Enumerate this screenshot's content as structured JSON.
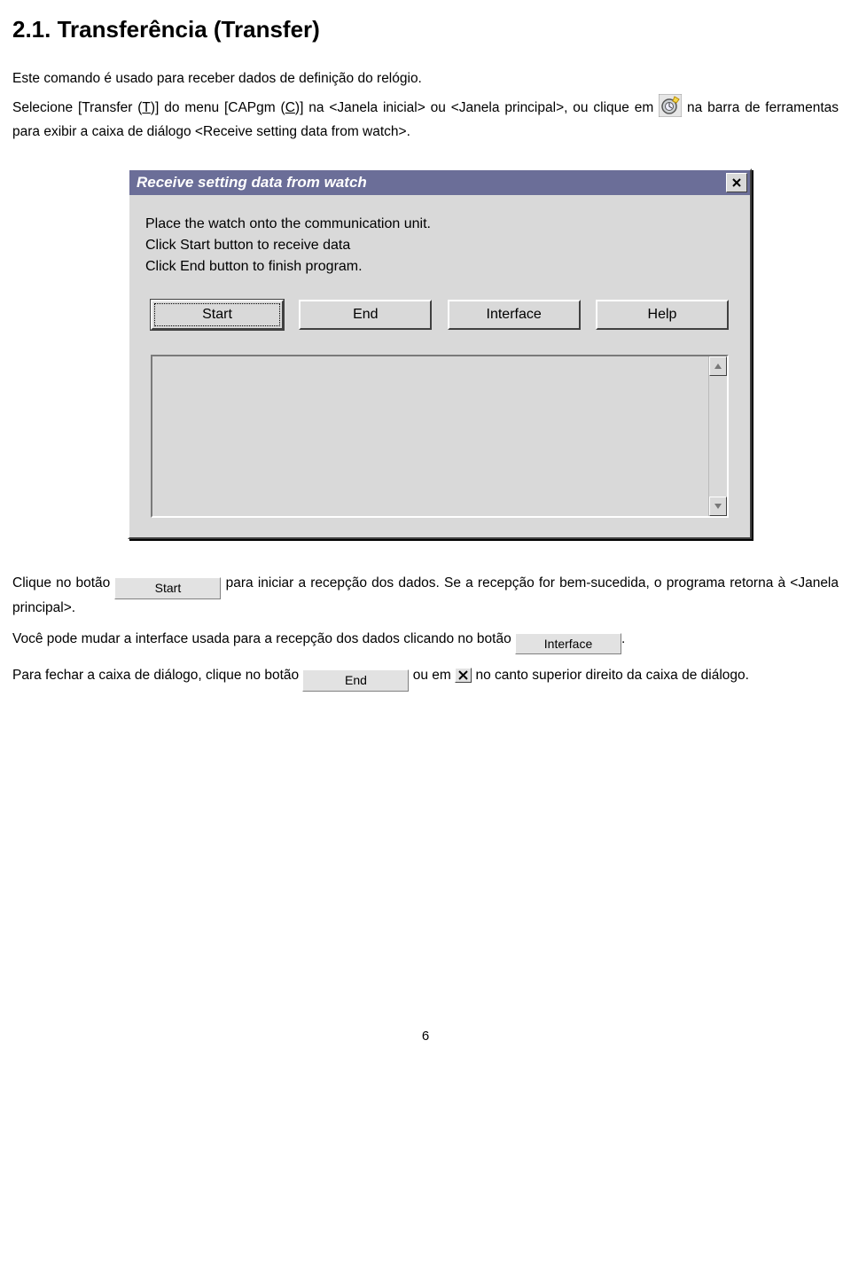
{
  "heading": "2.1. Transferência (Transfer)",
  "para1": "Este comando é usado para receber dados de definição do relógio.",
  "para2": {
    "pre": "Selecione [Transfer (",
    "t": "T",
    "mid1": ")] do menu [CAPgm (",
    "c": "C",
    "mid2": ")] na <Janela inicial> ou <Janela principal>, ou clique em ",
    "post": " na barra de ferramentas para exibir a caixa de diálogo <Receive setting data from watch>."
  },
  "dialog": {
    "title": "Receive setting data from watch",
    "msg1": "Place the watch onto the communication unit.",
    "msg2": "Click Start button to receive data",
    "msg3": "Click End button to finish program.",
    "buttons": {
      "start": "Start",
      "end": "End",
      "interface": "Interface",
      "help": "Help"
    }
  },
  "para3": {
    "pre": "Clique no botão ",
    "post": " para iniciar a recepção dos dados. Se a recepção for bem-sucedida, o programa retorna à <Janela principal>."
  },
  "para4": {
    "pre": "Você pode mudar a interface usada para a recepção dos dados clicando no botão ",
    "post": "."
  },
  "para5": {
    "pre": "Para fechar a caixa de diálogo, clique no botão ",
    "mid": " ou em ",
    "post": " no canto superior direito da caixa de diálogo."
  },
  "inline_buttons": {
    "start": "Start",
    "interface": "Interface",
    "end": "End"
  },
  "page_number": "6"
}
